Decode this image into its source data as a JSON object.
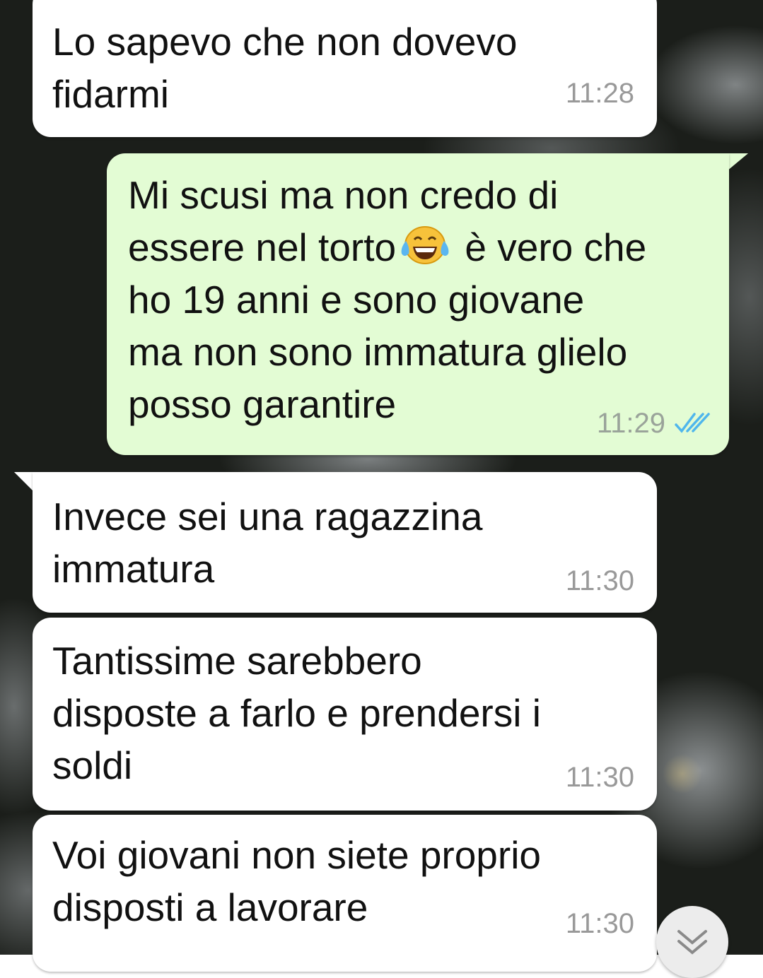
{
  "messages": [
    {
      "direction": "incoming",
      "text": "Lo sapevo che non dovevo\nfidarmi",
      "time": "11:28"
    },
    {
      "direction": "outgoing",
      "line1": "Mi scusi ma non credo di",
      "line2a": "essere nel torto",
      "emoji": "face-with-tears-of-joy",
      "line2b": " è vero che",
      "rest": "ho 19 anni e sono giovane\nma non sono immatura glielo\nposso garantire",
      "time": "11:29",
      "status": "read"
    },
    {
      "direction": "incoming",
      "text": "Invece sei una ragazzina\nimmatura",
      "time": "11:30"
    },
    {
      "direction": "incoming",
      "text": "Tantissime sarebbero\ndisposte a farlo e prendersi i\nsoldi",
      "time": "11:30"
    },
    {
      "direction": "incoming",
      "text": "Voi giovani non siete proprio\ndisposti a lavorare",
      "time": "11:30"
    }
  ],
  "colors": {
    "incoming_bubble": "#ffffff",
    "outgoing_bubble": "#e3fcd4",
    "read_ticks": "#4fb6ec"
  },
  "icons": {
    "scroll_down": "chevron-down-double-icon",
    "read_status": "double-check-icon"
  }
}
